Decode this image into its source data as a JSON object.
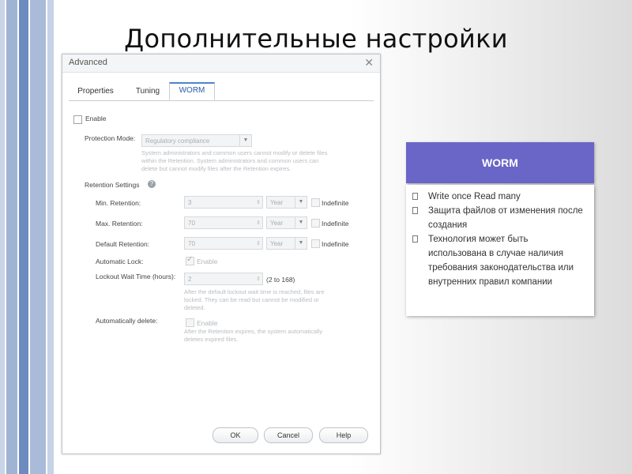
{
  "slide": {
    "title": "Дополнительные настройки"
  },
  "dialog": {
    "title": "Advanced",
    "close_icon": "close-icon",
    "tabs": [
      {
        "label": "Properties",
        "active": false
      },
      {
        "label": "Tuning",
        "active": false
      },
      {
        "label": "WORM",
        "active": true
      }
    ],
    "enable_label": "Enable",
    "protection_mode": {
      "label": "Protection Mode:",
      "value": "Regulatory compliance",
      "hint": [
        "System administrators and common users cannot modify or delete files",
        "within the Retention. System administrators and common users can",
        "delete but cannot modify files after the Retention expires."
      ]
    },
    "retention_settings": {
      "label": "Retention Settings",
      "help_icon": "question-icon",
      "min": {
        "label": "Min. Retention:",
        "value": "3",
        "unit": "Year",
        "indefinite": "Indefinite"
      },
      "max": {
        "label": "Max. Retention:",
        "value": "70",
        "unit": "Year",
        "indefinite": "Indefinite"
      },
      "default": {
        "label": "Default Retention:",
        "value": "70",
        "unit": "Year",
        "indefinite": "Indefinite"
      }
    },
    "automatic_lock": {
      "label": "Automatic Lock:",
      "enable": "Enable",
      "checked": true
    },
    "lockout_wait": {
      "label": "Lockout Wait Time (hours):",
      "value": "2",
      "range": "(2 to 168)",
      "hint": [
        "After the default lockout wait time is reached, files are",
        "locked. They can be read but cannot be modified or",
        "deleted."
      ]
    },
    "automatically_delete": {
      "label": "Automatically delete:",
      "enable": "Enable",
      "checked": false,
      "hint": [
        "After the Retention expires, the system automatically",
        "deletes expired files."
      ]
    },
    "buttons": {
      "ok": "OK",
      "cancel": "Cancel",
      "help": "Help"
    }
  },
  "worm_card": {
    "title": "WORM",
    "items": [
      "Write once Read many",
      "Защита файлов от изменения после создания",
      "Технология может быть использована в случае наличия требования законодательства или внутренних правил компании"
    ]
  },
  "colors": {
    "card_header": "#6a66c8",
    "active_tab": "#2a5ea8"
  }
}
